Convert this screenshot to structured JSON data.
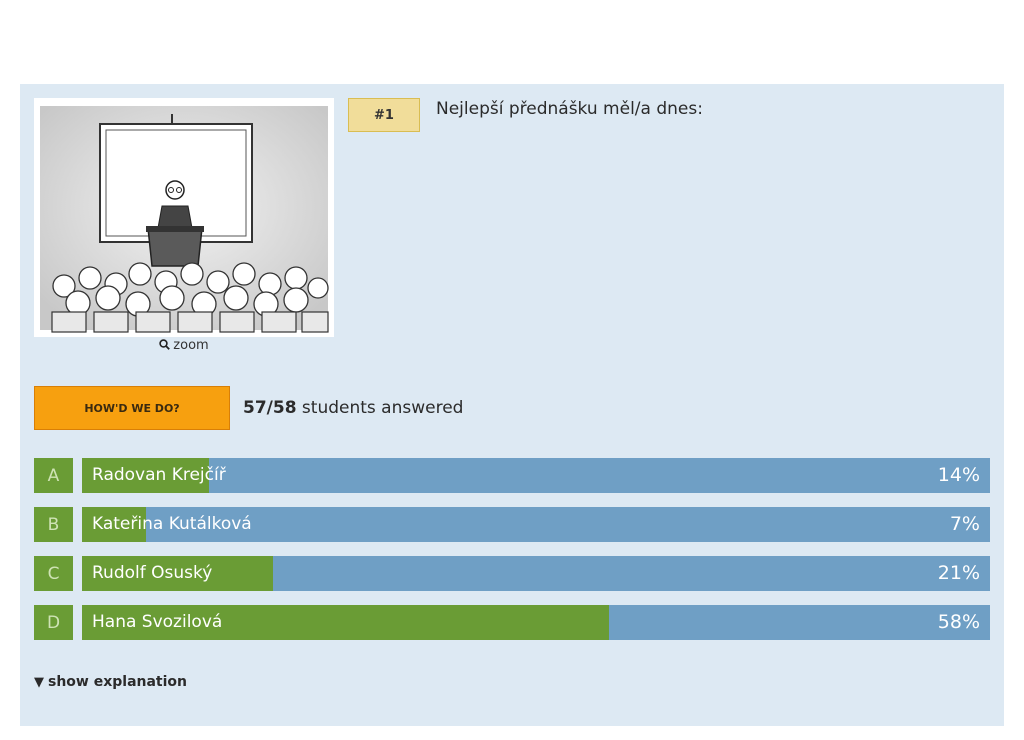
{
  "question": {
    "number": "#1",
    "text": "Nejlepší přednášku měl/a dnes:"
  },
  "image": {
    "zoom_label": "zoom"
  },
  "results": {
    "button_label": "HOW'D WE DO?",
    "answered_count": "57/58",
    "answered_suffix": " students answered"
  },
  "options": [
    {
      "letter": "A",
      "label": "Radovan Krejčíř",
      "percent_text": "14%",
      "value": 14
    },
    {
      "letter": "B",
      "label": "Kateřina Kutálková",
      "percent_text": "7%",
      "value": 7
    },
    {
      "letter": "C",
      "label": "Rudolf Osuský",
      "percent_text": "21%",
      "value": 21
    },
    {
      "letter": "D",
      "label": "Hana Svozilová",
      "percent_text": "58%",
      "value": 58
    }
  ],
  "explanation": {
    "toggle_label": "show explanation"
  },
  "colors": {
    "panel": "#dde9f3",
    "bar_bg": "#6f9fc5",
    "bar_fill": "#6a9c35",
    "button": "#f7a00f",
    "badge": "#f1dd9a"
  },
  "icons": {
    "zoom": "magnifier-icon",
    "toggle": "triangle-down-icon"
  }
}
